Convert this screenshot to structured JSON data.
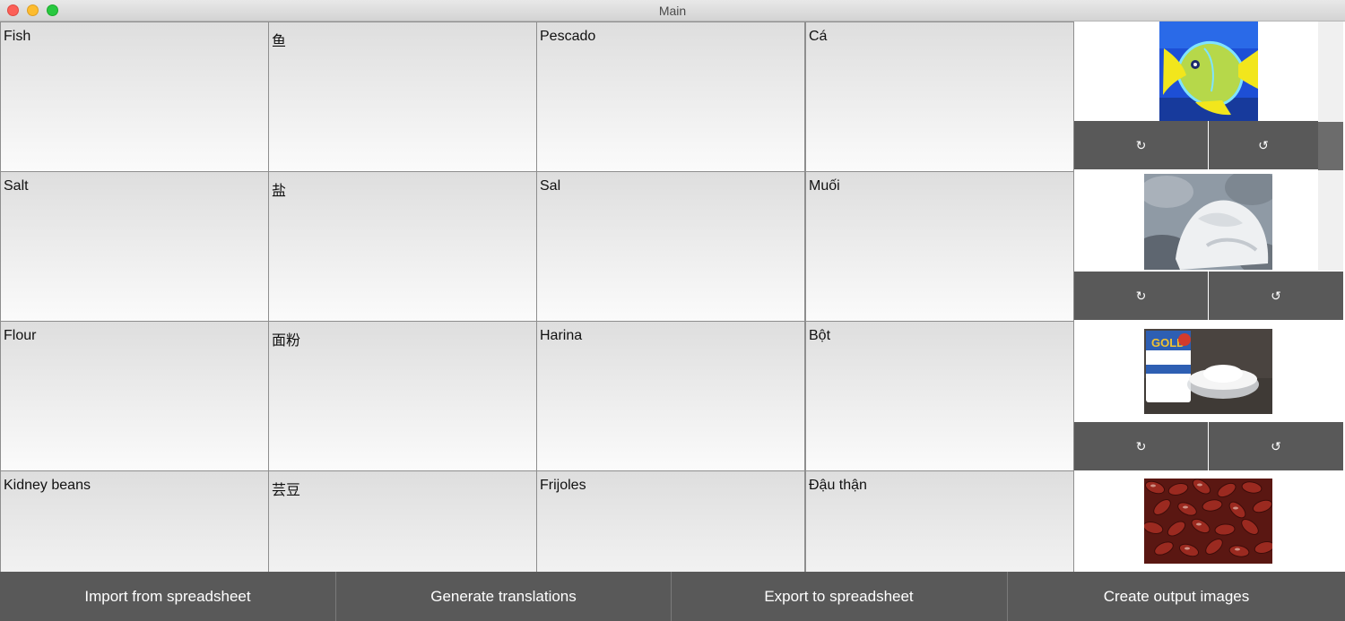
{
  "window": {
    "title": "Main"
  },
  "rows": [
    {
      "en": "Fish",
      "zh": "鱼",
      "es": "Pescado",
      "vi": "Cá",
      "image": "fish-photo"
    },
    {
      "en": "Salt",
      "zh": "盐",
      "es": "Sal",
      "vi": "Muối",
      "image": "salt-photo"
    },
    {
      "en": "Flour",
      "zh": "面粉",
      "es": "Harina",
      "vi": "Bột",
      "image": "flour-photo"
    },
    {
      "en": "Kidney beans",
      "zh": "芸豆",
      "es": "Frijoles",
      "vi": "Đậu thận",
      "image": "kidney-beans-photo"
    }
  ],
  "rotate": {
    "left_glyph": "↻",
    "right_glyph": "↺"
  },
  "toolbar": {
    "import_label": "Import from spreadsheet",
    "generate_label": "Generate translations",
    "export_label": "Export to spreadsheet",
    "create_label": "Create output images"
  },
  "colors": {
    "button_bg": "#595959",
    "button_text": "#ffffff",
    "cell_border": "#8e8e8e"
  }
}
